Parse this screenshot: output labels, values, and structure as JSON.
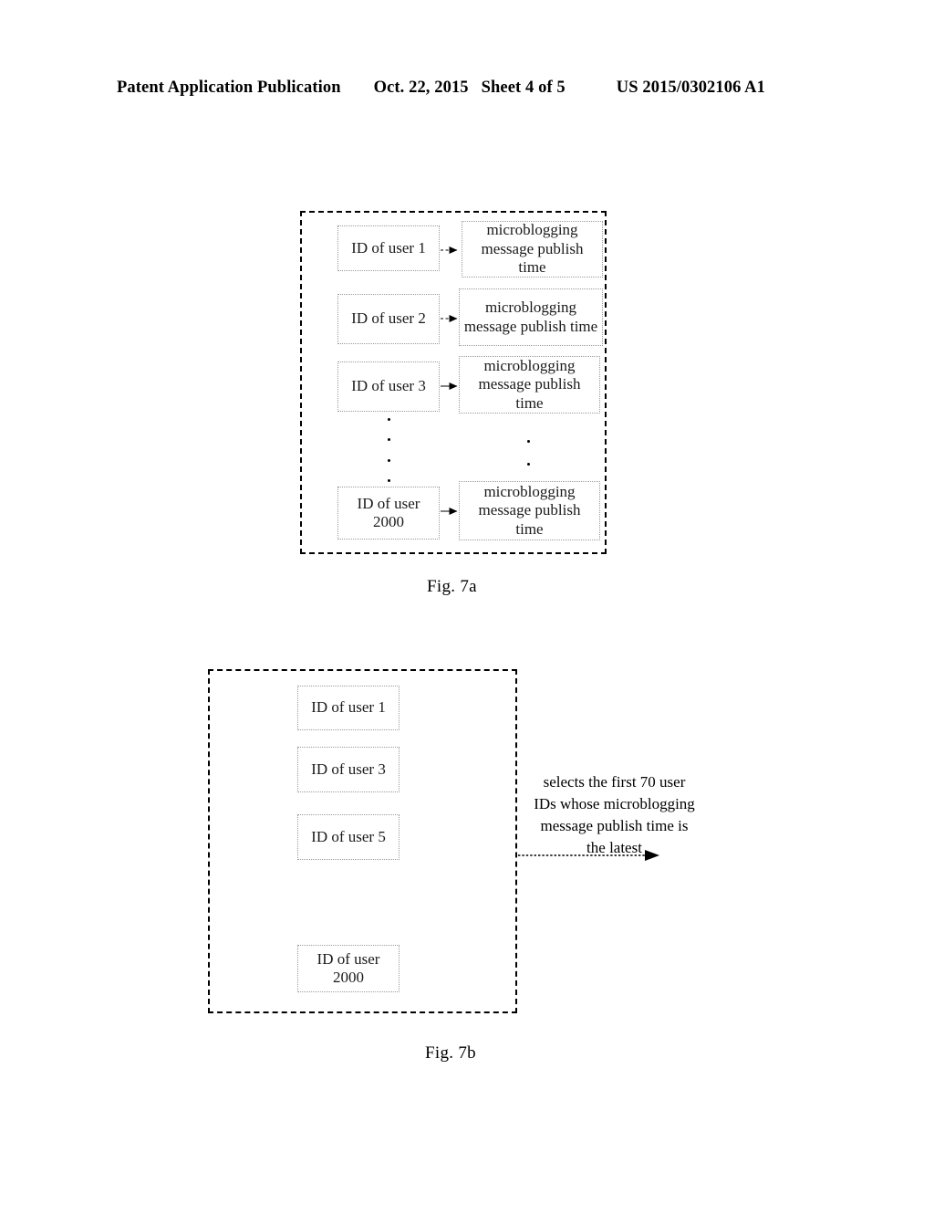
{
  "header": {
    "publication": "Patent Application Publication",
    "date": "Oct. 22, 2015",
    "sheet": "Sheet 4 of 5",
    "patent_number": "US 2015/0302106 A1"
  },
  "figures": [
    {
      "id": "fig-7a",
      "caption": "Fig. 7a",
      "rows": [
        {
          "id_label": "ID of user 1",
          "time_label": "microblogging message publish time"
        },
        {
          "id_label": "ID of user 2",
          "time_label": "microblogging message publish time"
        },
        {
          "id_label": "ID of user 3",
          "time_label": "microblogging message publish time"
        },
        {
          "id_label": "ID of user 2000",
          "time_label": "microblogging message publish time"
        }
      ],
      "ellipsis": "•"
    },
    {
      "id": "fig-7b",
      "caption": "Fig. 7b",
      "boxes": [
        {
          "label": "ID of user 1"
        },
        {
          "label": "ID of user 3"
        },
        {
          "label": "ID of user 5"
        },
        {
          "label": "ID of user 2000"
        }
      ],
      "annotation": "selects the first 70 user\nIDs whose microblogging\nmessage publish time is\nthe latest"
    }
  ],
  "colors": {
    "ink": "#000000",
    "box_border": "#9a9a9a",
    "page_background": "#ffffff"
  }
}
